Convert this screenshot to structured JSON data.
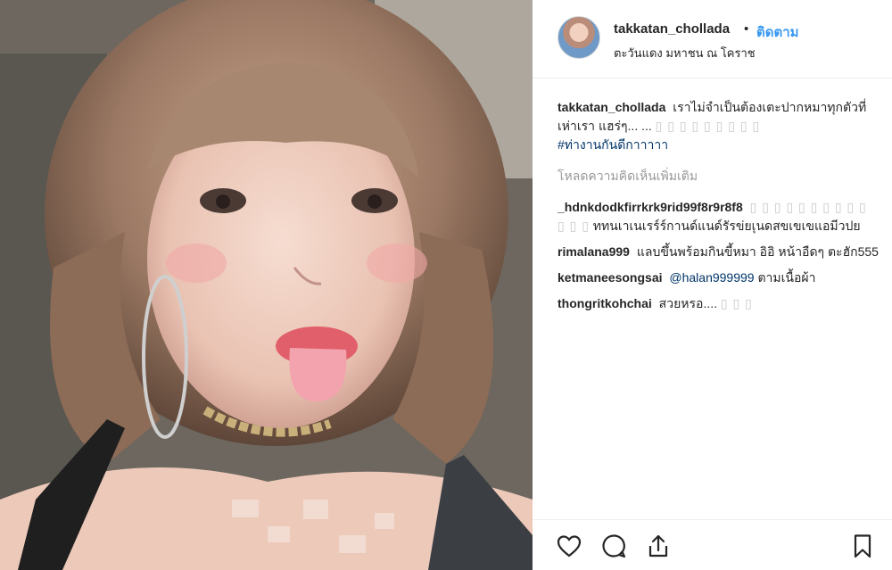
{
  "post": {
    "username": "takkatan_chollada",
    "separator": "•",
    "follow_label": "ติดตาม",
    "location": "ตะวันแดง มหาชน ณ โคราช",
    "caption": {
      "user": "takkatan_chollada",
      "text": "เราไม่จำเป็นต้องเตะปากหมาทุกตัวที่เห่าเรา",
      "text2": "แฮร่ๆ... ...",
      "glyphs": "▯ ▯ ▯ ▯ ▯ ▯ ▯ ▯ ▯",
      "hashtag": "#ท่างานกันดีกาาาาา"
    },
    "load_more": "โหลดความคิดเห็นเพิ่มเติม",
    "comments": [
      {
        "user": "_hdnkdodkfirrkrk9rid99f8r9r8f8",
        "glyphs": "▯ ▯ ▯ ▯ ▯ ▯ ▯ ▯ ▯ ▯ ▯ ▯ ▯",
        "text": "ททนเาเนเรร์ร์กานด์แนด์รัรข่ยเุนดสขเขเขแอมีวปย"
      },
      {
        "user": "rimalana999",
        "text": "แลบขึ้นพร้อมกินขี้หมา อิอิ หน้าอืดๆ ตะฮัก555"
      },
      {
        "user": "ketmaneesongsai",
        "tag": "@halan999999",
        "text": "ตามเนื้อผ้า"
      },
      {
        "user": "thongritkohchai",
        "text": "สวยหรอ....",
        "glyphs": "▯ ▯ ▯"
      }
    ]
  },
  "actions": {
    "like": "heart-icon",
    "comment": "comment-icon",
    "share": "share-icon",
    "save": "bookmark-icon"
  },
  "colors": {
    "link": "#3897f0",
    "text": "#262626",
    "muted": "#999999",
    "tag": "#003569"
  }
}
